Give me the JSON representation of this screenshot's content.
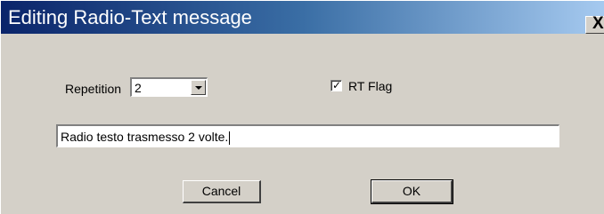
{
  "window": {
    "title": "Editing Radio-Text message",
    "close_glyph": "X"
  },
  "form": {
    "repetition_label": "Repetition",
    "repetition_value": "2",
    "rt_flag_label": "RT Flag",
    "rt_flag_checked": true,
    "rt_flag_check_glyph": "✓",
    "message_value": "Radio testo trasmesso 2 volte."
  },
  "buttons": {
    "cancel_label": "Cancel",
    "ok_label": "OK"
  },
  "colors": {
    "title_gradient_start": "#0a246a",
    "title_gradient_end": "#a6caf0",
    "dialog_face": "#d4d0c8"
  }
}
